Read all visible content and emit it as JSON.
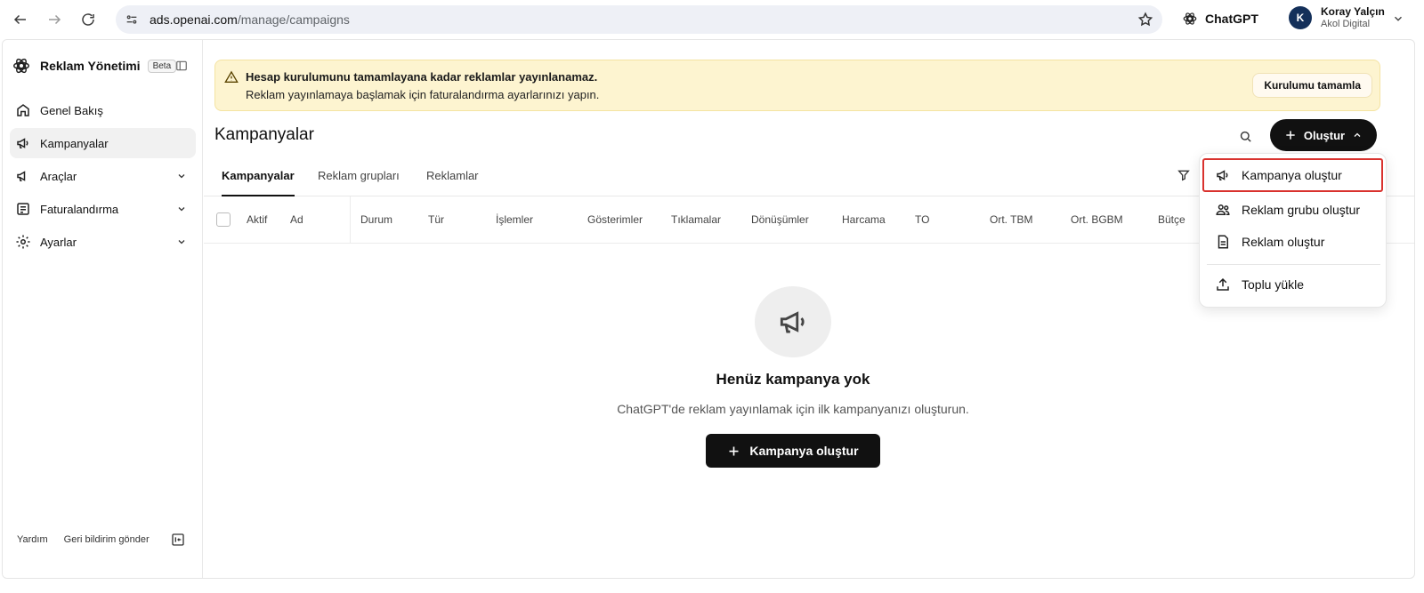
{
  "browser": {
    "url_host": "ads.openai.com",
    "url_path": "/manage/campaigns",
    "chatgpt_label": "ChatGPT",
    "account": {
      "initial": "K",
      "name": "Koray Yalçın",
      "org": "Akol Digital"
    }
  },
  "sidebar": {
    "brand_title": "Reklam Yönetimi",
    "beta_label": "Beta",
    "items": [
      {
        "label": "Genel Bakış",
        "icon": "home-icon"
      },
      {
        "label": "Kampanyalar",
        "icon": "megaphone-icon",
        "active": true
      },
      {
        "label": "Araçlar",
        "icon": "megaphone-icon",
        "expandable": true
      },
      {
        "label": "Faturalandırma",
        "icon": "billing-icon",
        "expandable": true
      },
      {
        "label": "Ayarlar",
        "icon": "gear-icon",
        "expandable": true
      }
    ],
    "footer": {
      "help": "Yardım",
      "feedback": "Geri bildirim gönder"
    }
  },
  "banner": {
    "title": "Hesap kurulumunu tamamlayana kadar reklamlar yayınlanamaz.",
    "text": "Reklam yayınlamaya başlamak için faturalandırma ayarlarınızı yapın.",
    "button": "Kurulumu tamamla"
  },
  "page": {
    "title": "Kampanyalar",
    "create_button": "Oluştur"
  },
  "tabs": [
    "Kampanyalar",
    "Reklam grupları",
    "Reklamlar"
  ],
  "table": {
    "columns": [
      "Aktif",
      "Ad",
      "Durum",
      "Tür",
      "İşlemler",
      "Gösterimler",
      "Tıklamalar",
      "Dönüşümler",
      "Harcama",
      "TO",
      "Ort. TBM",
      "Ort. BGBM",
      "Bütçe"
    ]
  },
  "empty_state": {
    "title": "Henüz kampanya yok",
    "subtitle": "ChatGPT'de reklam yayınlamak için ilk kampanyanızı oluşturun.",
    "button": "Kampanya oluştur"
  },
  "dropdown": {
    "items": [
      {
        "label": "Kampanya oluştur",
        "icon": "megaphone-icon"
      },
      {
        "label": "Reklam grubu oluştur",
        "icon": "users-icon"
      },
      {
        "label": "Reklam oluştur",
        "icon": "document-icon"
      },
      {
        "label": "Toplu yükle",
        "icon": "upload-icon"
      }
    ]
  },
  "colors": {
    "accent": "#111111",
    "banner_bg": "#fdf4d0",
    "highlight": "#d9322e",
    "avatar": "#14305a"
  }
}
